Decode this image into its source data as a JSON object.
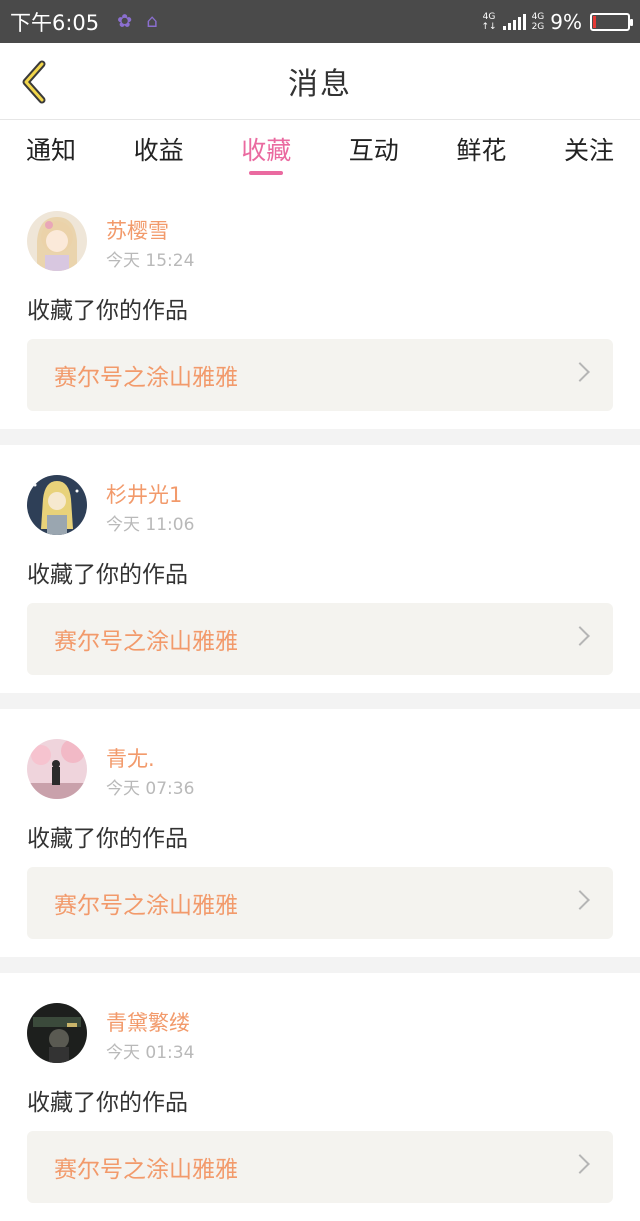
{
  "status_bar": {
    "time": "下午6:05",
    "network_top": "4G",
    "network_mid": "4G",
    "network_bottom": "2G",
    "battery_text": "9%",
    "battery_level": 0.09,
    "battery_color": "#e53935"
  },
  "header": {
    "title": "消息",
    "back_icon": "chevron-left-icon"
  },
  "tabs": [
    {
      "label": "通知",
      "active": false
    },
    {
      "label": "收益",
      "active": false
    },
    {
      "label": "收藏",
      "active": true
    },
    {
      "label": "互动",
      "active": false
    },
    {
      "label": "鲜花",
      "active": false
    },
    {
      "label": "关注",
      "active": false
    }
  ],
  "colors": {
    "accent": "#ea6aa0",
    "user_name": "#f29a6b",
    "work_box_bg": "#f4f3ef"
  },
  "messages": [
    {
      "user": "苏樱雪",
      "time": "今天 15:24",
      "action": "收藏了你的作品",
      "work": "赛尔号之涂山雅雅"
    },
    {
      "user": "杉井光1",
      "time": "今天 11:06",
      "action": "收藏了你的作品",
      "work": "赛尔号之涂山雅雅"
    },
    {
      "user": "青尢.",
      "time": "今天 07:36",
      "action": "收藏了你的作品",
      "work": "赛尔号之涂山雅雅"
    },
    {
      "user": "青黛繁缕",
      "time": "今天 01:34",
      "action": "收藏了你的作品",
      "work": "赛尔号之涂山雅雅"
    }
  ]
}
